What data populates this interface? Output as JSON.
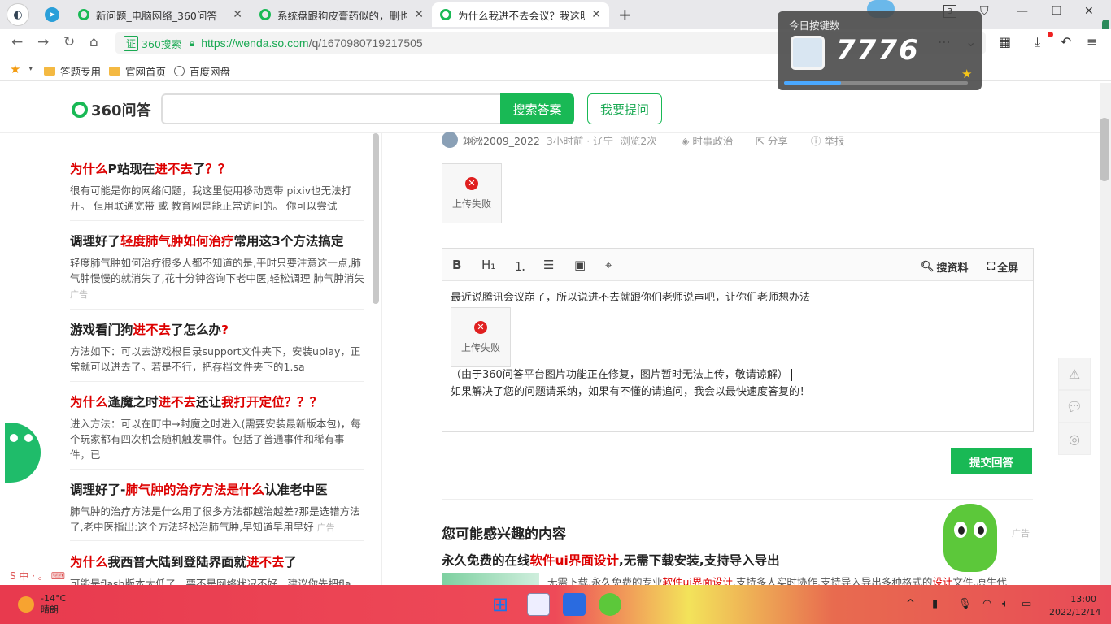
{
  "browser": {
    "tabs": [
      {
        "title": "新问题_电脑网络_360问答"
      },
      {
        "title": "系统盘跟狗皮膏药似的，删也删"
      },
      {
        "title": "为什么我进不去会议？我这明明"
      }
    ],
    "badge": "3",
    "address": {
      "brand": "360搜索",
      "cert": "证",
      "host": "https://wenda.so.com",
      "path": "/q/1670980719217505"
    },
    "bookmarks": [
      {
        "label": "答题专用"
      },
      {
        "label": "官网首页"
      },
      {
        "label": "百度网盘"
      }
    ]
  },
  "overlay": {
    "label": "今日按键数",
    "count": "7776",
    "progress": 0.31
  },
  "site": {
    "logo": "360问答",
    "search_placeholder": "",
    "search_button": "搜索答案",
    "ask_button": "我要提问"
  },
  "left": {
    "items": [
      {
        "t1": "为什么",
        "t2": "P站现在",
        "t3": "进不去",
        "t4": "了",
        "t5": "？？",
        "desc": "很有可能是你的网络问题，我这里使用移动宽带 pixiv也无法打开。 但用联通宽带 或 教育网是能正常访问的。 你可以尝试",
        "ad": ""
      },
      {
        "t1": "",
        "t2": "调理好了",
        "t3": "轻度肺气肿如何治疗",
        "t4": "常用这3个方法搞定",
        "t5": "",
        "desc": "轻度肺气肿如何治疗很多人都不知道的是,平时只要注意这一点,肺气肿慢慢的就消失了,花十分钟咨询下老中医,轻松调理 肺气肿消失",
        "ad": "广告"
      },
      {
        "t1": "",
        "t2": "游戏看门狗",
        "t3": "进不去",
        "t4": "了怎么办",
        "t5": "?",
        "desc": " 方法如下：可以去游戏根目录support文件夹下，安装uplay，正常就可以进去了。若是不行，把存档文件夹下的1.sa",
        "ad": ""
      },
      {
        "t1": "为什么",
        "t2": "逢魔之时",
        "t3": "进不去",
        "t4": "还让",
        "t5": "我打开定位？？？",
        "desc": "进入方法：可以在町中→封魔之时进入(需要安装最新版本包)，每个玩家都有四次机会随机触发事件。包括了普通事件和稀有事件，已",
        "ad": ""
      },
      {
        "t1": "",
        "t2": "调理好了-",
        "t3": "肺气肿的治疗方法是什么",
        "t4": "认准老中医",
        "t5": "",
        "desc": "肺气肿的治疗方法是什么用了很多方法都越治越差?那是选错方法了,老中医指出:这个方法轻松治肺气肿,早知道早用早好",
        "ad": "广告"
      },
      {
        "t1": "为什么",
        "t2": "我西普大陆到登陆界面就",
        "t3": "进不去",
        "t4": "了",
        "t5": "",
        "desc": "可能是flash版本太低了，要不是网络状况不好，建议你先把fla",
        "ad": ""
      }
    ]
  },
  "question": {
    "user": "翊淞2009_2022",
    "time": "3小时前 · 辽宁",
    "views": "浏览2次",
    "category": "时事政治",
    "share": "分享",
    "report": "举报",
    "image_fail": "上传失败"
  },
  "editor": {
    "search_material": "搜资料",
    "fullscreen": "全屏",
    "line1": "最近说腾讯会议崩了，所以说进不去就跟你们老师说声吧，让你们老师想办法",
    "image_fail": "上传失败",
    "line2": "（由于360问答平台图片功能正在修复，图片暂时无法上传，敬请谅解）",
    "line3": "如果解决了您的问题请采纳，如果有不懂的请追问，我会以最快速度答复的！",
    "submit": "提交回答"
  },
  "recommend": {
    "heading": "您可能感兴趣的内容",
    "ad": "广告",
    "title_a": "永久免费的在线",
    "title_b": "软件ui界面设计",
    "title_c": ",无需下载安装,支持导入导出",
    "desc_a": "无需下载,永久免费的专业",
    "desc_b": "软件ui界面设计",
    "desc_c": ",支持多人实时协作,支持导入导出多种格式的",
    "desc_d": "设计",
    "desc_e": "文件,原生代"
  },
  "ime": "S 中 · 。 ⌨",
  "taskbar": {
    "temp": "-14°C",
    "condition": "晴朗",
    "time": "13:00",
    "date": "2022/12/14"
  }
}
